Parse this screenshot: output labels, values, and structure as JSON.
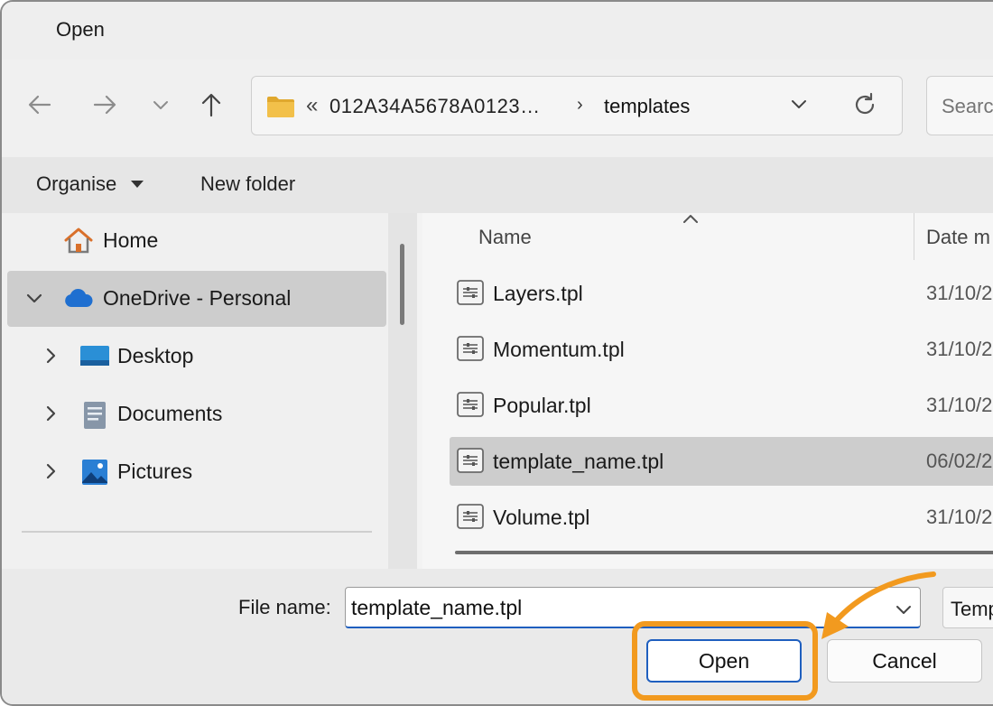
{
  "window": {
    "title": "Open"
  },
  "navigation": {
    "back_icon": "arrow-left-icon",
    "forward_icon": "arrow-right-icon",
    "recent_icon": "chevron-down-icon",
    "up_icon": "arrow-up-icon"
  },
  "address_bar": {
    "overflow_glyph": "«",
    "path": [
      "012A34A5678A0123…",
      "templates"
    ],
    "separator": "›"
  },
  "search": {
    "placeholder": "Search"
  },
  "toolbar": {
    "organise_label": "Organise",
    "new_folder_label": "New folder"
  },
  "nav_pane": {
    "items": [
      {
        "label": "Home",
        "icon": "home-icon",
        "selected": false,
        "expandable": false
      },
      {
        "label": "OneDrive - Personal",
        "icon": "cloud-icon",
        "selected": true,
        "expanded": true
      },
      {
        "label": "Desktop",
        "icon": "desktop-icon",
        "selected": false,
        "expandable": true
      },
      {
        "label": "Documents",
        "icon": "documents-icon",
        "selected": false,
        "expandable": true
      },
      {
        "label": "Pictures",
        "icon": "pictures-icon",
        "selected": false,
        "expandable": true
      }
    ]
  },
  "file_list": {
    "columns": {
      "name": "Name",
      "date": "Date m"
    },
    "files": [
      {
        "name": "Layers.tpl",
        "date": "31/10/2",
        "selected": false
      },
      {
        "name": "Momentum.tpl",
        "date": "31/10/2",
        "selected": false
      },
      {
        "name": "Popular.tpl",
        "date": "31/10/2",
        "selected": false
      },
      {
        "name": "template_name.tpl",
        "date": "06/02/2",
        "selected": true
      },
      {
        "name": "Volume.tpl",
        "date": "31/10/2",
        "selected": false
      }
    ]
  },
  "footer": {
    "file_name_label": "File name:",
    "file_name_value": "template_name.tpl",
    "file_type_value": "Temp",
    "open_label": "Open",
    "cancel_label": "Cancel"
  },
  "colors": {
    "accent": "#1f5fbf",
    "highlight": "#f29a1f",
    "selected_row": "#cdcdcd"
  }
}
